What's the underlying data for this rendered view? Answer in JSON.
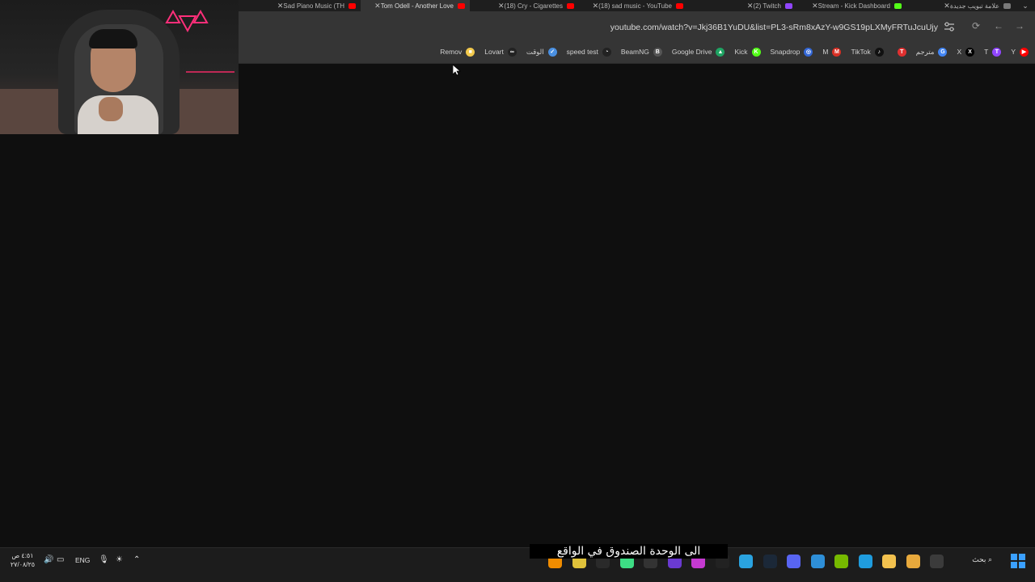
{
  "tabs": [
    {
      "title": "علامة تبويب جديدة",
      "fav_color": "#7a7a7a",
      "active": false
    },
    {
      "title": "Stream - Kick Dashboard",
      "fav_color": "#53fc18",
      "active": false
    },
    {
      "title": "(2) Twitch",
      "fav_color": "#9146ff",
      "active": false
    },
    {
      "title": "(18) sad music - YouTube",
      "fav_color": "#ff0000",
      "active": false
    },
    {
      "title": "(18) Cry - Cigarettes",
      "fav_color": "#ff0000",
      "active": false
    },
    {
      "title": "Tom Odell - Another Love",
      "fav_color": "#ff0000",
      "active": true
    },
    {
      "title": "Sad Piano Music (TH",
      "fav_color": "#ff0000",
      "active": false
    }
  ],
  "address": {
    "url": "youtube.com/watch?v=Jkj36B1YuDU&list=PL3-sRm8xAzY-w9GS19pLXMyFRTuJcuUjy"
  },
  "bookmarks": [
    {
      "label": "Y",
      "icon": "youtube-icon",
      "color": "#ff0000",
      "glyph": "▶"
    },
    {
      "label": "T",
      "icon": "twitch-icon",
      "color": "#9146ff",
      "glyph": "T"
    },
    {
      "label": "X",
      "icon": "x-icon",
      "color": "#000000",
      "glyph": "X"
    },
    {
      "label": "مترجم",
      "icon": "google-translate-icon",
      "color": "#4285f4",
      "glyph": "G"
    },
    {
      "label": "",
      "icon": "top-icon",
      "color": "#e03030",
      "glyph": "T"
    },
    {
      "label": "TikTok",
      "icon": "tiktok-icon",
      "color": "#111111",
      "glyph": "♪"
    },
    {
      "label": "M",
      "icon": "gmail-icon",
      "color": "#d93025",
      "glyph": "M"
    },
    {
      "label": "Snapdrop",
      "icon": "snapdrop-icon",
      "color": "#3367d6",
      "glyph": "◎"
    },
    {
      "label": "Kick",
      "icon": "kick-icon",
      "color": "#53fc18",
      "glyph": "K"
    },
    {
      "label": "Google Drive",
      "icon": "drive-icon",
      "color": "#1fa463",
      "glyph": "▲"
    },
    {
      "label": "BeamNG",
      "icon": "beamng-icon",
      "color": "#555555",
      "glyph": "B"
    },
    {
      "label": "speed test",
      "icon": "speedtest-icon",
      "color": "#222222",
      "glyph": "◔"
    },
    {
      "label": "الوقت",
      "icon": "time-icon",
      "color": "#4a90e2",
      "glyph": "✓"
    },
    {
      "label": "Lovart",
      "icon": "lovart-icon",
      "color": "#222222",
      "glyph": "∞"
    },
    {
      "label": "Remov",
      "icon": "remove-bg-icon",
      "color": "#f2c94c",
      "glyph": "■"
    }
  ],
  "subtitle": "الى الوحدة الصندوق في الواقع",
  "taskbar": {
    "search_label": "بحث",
    "language": "ENG",
    "clock_time": "٤:٥١ ص",
    "clock_date": "٢٧/٠٨/٢٥",
    "apps": [
      {
        "icon": "file-explorer-icon",
        "color": "#3b3b3b"
      },
      {
        "icon": "copilot-icon",
        "color": "#e8a93c"
      },
      {
        "icon": "folder-icon",
        "color": "#f2c14e"
      },
      {
        "icon": "edge-icon",
        "color": "#1f9cde"
      },
      {
        "icon": "nvidia-icon",
        "color": "#76b900"
      },
      {
        "icon": "store-icon",
        "color": "#2e8fd8"
      },
      {
        "icon": "discord-icon",
        "color": "#5865f2"
      },
      {
        "icon": "steam-icon",
        "color": "#1b2838"
      },
      {
        "icon": "telegram-icon",
        "color": "#2aa3e0"
      },
      {
        "icon": "capcut-icon",
        "color": "#222222"
      },
      {
        "icon": "obs-icon",
        "color": "#c53ad1"
      },
      {
        "icon": "grid-app-icon",
        "color": "#6a3ad1"
      },
      {
        "icon": "github-icon",
        "color": "#333333"
      },
      {
        "icon": "android-icon",
        "color": "#3ddc84"
      },
      {
        "icon": "epic-icon",
        "color": "#2a2a2a"
      },
      {
        "icon": "chrome-icon",
        "color": "#e0c23a"
      },
      {
        "icon": "vlc-icon",
        "color": "#f08c00"
      }
    ]
  }
}
